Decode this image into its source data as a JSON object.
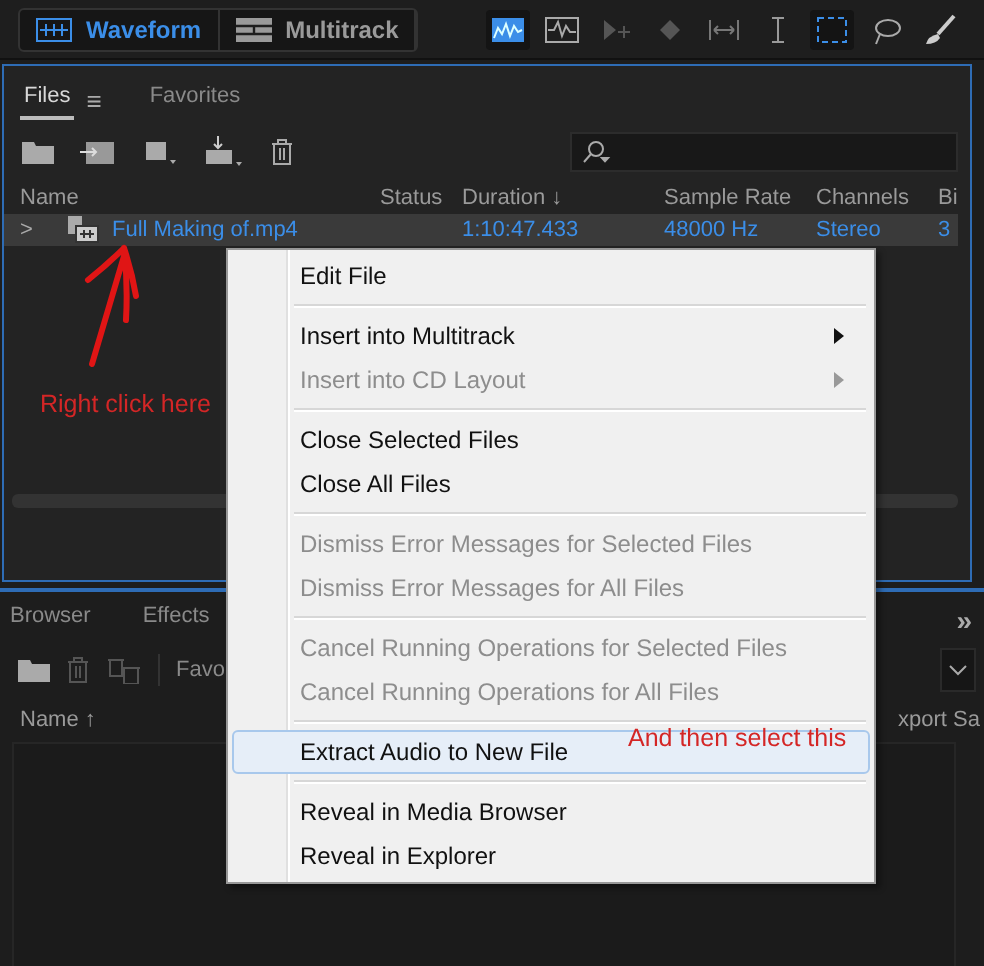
{
  "toolbar": {
    "modes": [
      {
        "label": "Waveform",
        "selected": true
      },
      {
        "label": "Multitrack",
        "selected": false
      }
    ],
    "tools": [
      {
        "kind": "spectral",
        "selected": true
      },
      {
        "kind": "waveform",
        "selected": false
      },
      {
        "kind": "move",
        "selected": false
      },
      {
        "kind": "razor",
        "selected": false
      },
      {
        "kind": "time",
        "selected": false
      },
      {
        "kind": "ibeam",
        "selected": false
      },
      {
        "kind": "marquee",
        "selected": true
      },
      {
        "kind": "lasso",
        "selected": false
      },
      {
        "kind": "brush",
        "selected": false
      }
    ]
  },
  "files_panel": {
    "tabs": [
      {
        "label": "Files",
        "selected": true,
        "menu_icon": "≡"
      },
      {
        "label": "Favorites",
        "selected": false
      }
    ],
    "columns": [
      "Name",
      "Status",
      "Duration ↓",
      "Sample Rate",
      "Channels",
      "Bi"
    ],
    "rows": [
      {
        "expander": ">",
        "name": "Full Making of.mp4",
        "duration": "1:10:47.433",
        "sample_rate": "48000 Hz",
        "channels": "Stereo",
        "column_6": "3",
        "selected": true
      }
    ]
  },
  "bottom_panel": {
    "tabs": [
      {
        "label": "Browser",
        "selected": false
      },
      {
        "label": "Effects",
        "selected": false
      }
    ],
    "more": "»",
    "favorites_dropdown": "Favo",
    "columns": [
      "Name ↑",
      "xport Sa"
    ]
  },
  "context_menu": {
    "groups": [
      [
        {
          "label": "Edit File",
          "disabled": false,
          "submenu": false,
          "selected": false
        }
      ],
      [
        {
          "label": "Insert into Multitrack",
          "disabled": false,
          "submenu": true,
          "selected": false
        },
        {
          "label": "Insert into CD Layout",
          "disabled": true,
          "submenu": true,
          "selected": false
        }
      ],
      [
        {
          "label": "Close Selected Files",
          "disabled": false,
          "submenu": false,
          "selected": false
        },
        {
          "label": "Close All Files",
          "disabled": false,
          "submenu": false,
          "selected": false
        }
      ],
      [
        {
          "label": "Dismiss Error Messages for Selected Files",
          "disabled": true,
          "submenu": false,
          "selected": false
        },
        {
          "label": "Dismiss Error Messages for All Files",
          "disabled": true,
          "submenu": false,
          "selected": false
        }
      ],
      [
        {
          "label": "Cancel Running Operations for Selected Files",
          "disabled": true,
          "submenu": false,
          "selected": false
        },
        {
          "label": "Cancel Running Operations for All Files",
          "disabled": true,
          "submenu": false,
          "selected": false
        }
      ],
      [
        {
          "label": "Extract Audio to New File",
          "disabled": false,
          "submenu": false,
          "selected": true
        }
      ],
      [
        {
          "label": "Reveal in Media Browser",
          "disabled": false,
          "submenu": false,
          "selected": false
        },
        {
          "label": "Reveal in Explorer",
          "disabled": false,
          "submenu": false,
          "selected": false
        }
      ]
    ]
  },
  "annotations": [
    "Right click here",
    "And then select this"
  ]
}
